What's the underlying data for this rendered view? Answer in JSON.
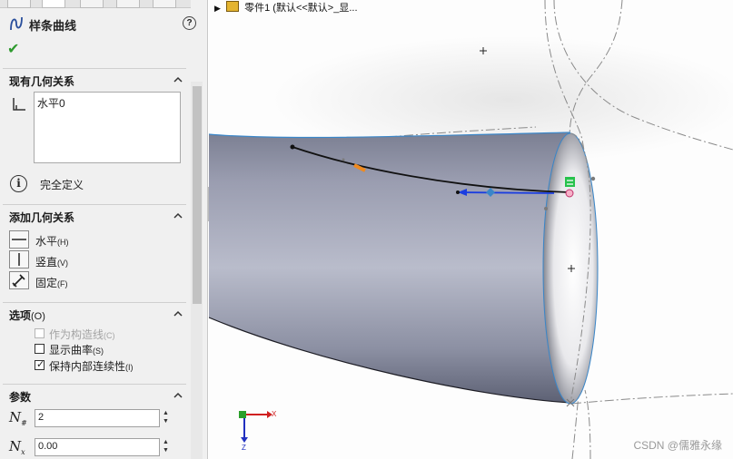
{
  "panel": {
    "title": "样条曲线",
    "help_icon": "help-icon",
    "ok_icon": "checkmark-icon",
    "sections": {
      "existing": {
        "title": "现有几何关系",
        "items": [
          "水平0"
        ],
        "status": "完全定义"
      },
      "add": {
        "title": "添加几何关系",
        "horizontal": "水平",
        "horizontal_key": "(H)",
        "vertical": "竖直",
        "vertical_key": "(V)",
        "fix": "固定",
        "fix_key": "(F)"
      },
      "options": {
        "title": "选项",
        "title_key": "(O)",
        "construction": "作为构造线",
        "construction_key": "(C)",
        "construction_checked": false,
        "construction_enabled": false,
        "curvature": "显示曲率",
        "curvature_key": "(S)",
        "curvature_checked": false,
        "continuity": "保持内部连续性",
        "continuity_key": "(I)",
        "continuity_checked": true
      },
      "params": {
        "title": "参数",
        "point_count": "2",
        "x_coord": "0.00"
      }
    }
  },
  "viewport": {
    "tree_item": "零件1  (默认<<默认>_显...",
    "watermark": "CSDN @儒雅永缘",
    "triad": {
      "x": "X",
      "z": "Z"
    },
    "colors": {
      "body_dark": "#55596a",
      "body_light": "#b9bccb",
      "edge_blue": "#3a86c8",
      "arrow_blue": "#1a3de0",
      "handle_orange": "#f08a1e",
      "relation_green": "#27c24c"
    }
  }
}
